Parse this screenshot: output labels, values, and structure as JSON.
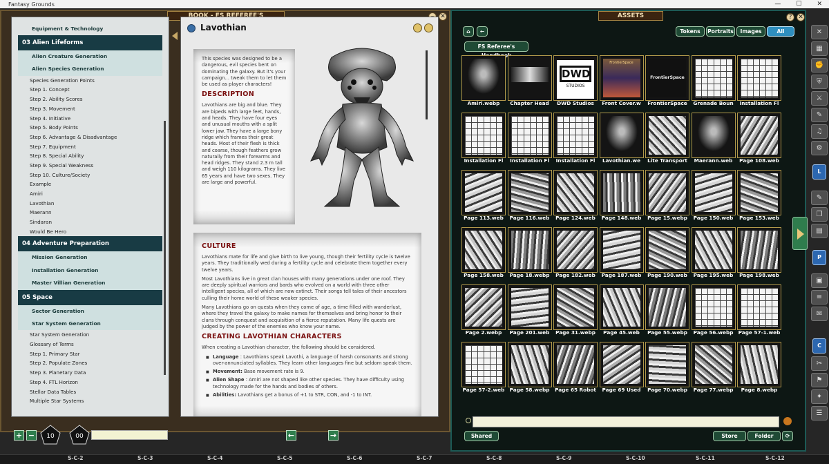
{
  "app": {
    "title": "Fantasy Grounds",
    "minimize": "—",
    "maximize": "☐",
    "close": "✕"
  },
  "book": {
    "title": "BOOK - FS REFEREE'S HANDBOOK",
    "toc": [
      {
        "level": "top",
        "label": "Equipment & Technology"
      },
      {
        "level": 1,
        "label": "03 Alien Lifeforms"
      },
      {
        "level": 2,
        "label": "Alien Creature Generation"
      },
      {
        "level": 2,
        "label": "Alien Species Generation"
      },
      {
        "level": 3,
        "label": "Species Generation Points"
      },
      {
        "level": 3,
        "label": "Step 1. Concept"
      },
      {
        "level": 3,
        "label": "Step 2. Ability Scores"
      },
      {
        "level": 3,
        "label": "Step 3. Movement"
      },
      {
        "level": 3,
        "label": "Step 4. Initiative"
      },
      {
        "level": 3,
        "label": "Step 5. Body Points"
      },
      {
        "level": 3,
        "label": "Step 6. Advantage & Disadvantage"
      },
      {
        "level": 3,
        "label": "Step 7. Equipment"
      },
      {
        "level": 3,
        "label": "Step 8. Special Ability"
      },
      {
        "level": 3,
        "label": "Step 9. Special Weakness"
      },
      {
        "level": 3,
        "label": "Step 10. Culture/Society"
      },
      {
        "level": 3,
        "label": "Example"
      },
      {
        "level": 3,
        "label": "Amiri"
      },
      {
        "level": 3,
        "label": "Lavothian"
      },
      {
        "level": 3,
        "label": "Maerann"
      },
      {
        "level": 3,
        "label": "Sindaran"
      },
      {
        "level": 3,
        "label": "Would Be Hero"
      },
      {
        "level": 1,
        "label": "04 Adventure Preparation"
      },
      {
        "level": 2,
        "label": "Mission Generation"
      },
      {
        "level": 2,
        "label": "Installation Generation"
      },
      {
        "level": 2,
        "label": "Master Villian Generation"
      },
      {
        "level": 1,
        "label": "05 Space"
      },
      {
        "level": 2,
        "label": "Sector Generation"
      },
      {
        "level": 2,
        "label": "Star System Generation"
      },
      {
        "level": 3,
        "label": "Star System Generation"
      },
      {
        "level": 3,
        "label": "Glossary of Terms"
      },
      {
        "level": 3,
        "label": "Step 1. Primary Star"
      },
      {
        "level": 3,
        "label": "Step 2. Populate Zones"
      },
      {
        "level": 3,
        "label": "Step 3. Planetary Data"
      },
      {
        "level": 3,
        "label": "Step 4. FTL Horizon"
      },
      {
        "level": 3,
        "label": "Stellar Data Tables"
      },
      {
        "level": 3,
        "label": "Multiple Star Systems"
      }
    ],
    "page": {
      "title": "Lavothian",
      "intro": "This species was designed to be a dangerous, evil species bent on dominating the galaxy. But it's your campaign... tweak them to let them be used as player characters!",
      "description_heading": "DESCRIPTION",
      "description": "Lavothians are big and blue. They are bipeds with large feet, hands, and heads. They have four eyes and unusual mouths with a split lower jaw. They have a large bony ridge which frames their great heads. Most of their flesh is thick and coarse, though feathers grow naturally from their forearms and head ridges. They stand 2.3 m tall and weigh 110 kilograms. They live 65 years and have two sexes. They are large and powerful.",
      "culture_heading": "CULTURE",
      "culture_p1": "Lavothians mate for life and give birth to live young, though their fertility cycle is twelve years. They traditionally wed during a fertility cycle and celebrate them together every twelve years.",
      "culture_p2": "Most Lavothians live in great clan houses with many generations under one roof. They are deeply spiritual warriors and bards who evolved on a world with three other intelligent species, all of which are now extinct. Their songs tell tales of their ancestors culling their home world of these weaker species.",
      "culture_p3": "Many Lavothians go on quests when they come of age, a time filled with wanderlust, where they travel the galaxy to make names for themselves and bring honor to their clans through conquest and acquisition of a fierce reputation. Many life quests are judged by the power of the enemies who know your name.",
      "creating_heading": "CREATING LAVOTHIAN CHARACTERS",
      "creating_intro": "When creating a Lavothian character, the following should be considered.",
      "bullets": [
        {
          "term": "Language",
          "text": " : Lavothians speak Lavothi, a language of harsh consonants and strong over-annunciated syllables. They learn other languages fine but seldom speak them."
        },
        {
          "term": "Movement:",
          "text": " Base movement rate is 9."
        },
        {
          "term": "Alien Shape",
          "text": " : Amiri are not shaped like other species. They have difficulty using technology made for the hands and bodies of others."
        },
        {
          "term": "Abilities:",
          "text": " Lavothians get a bonus of +1 to STR, CON, and -1 to INT."
        }
      ]
    },
    "dice": {
      "d10": "10",
      "d100": "00"
    },
    "plus": "+",
    "minus": "−",
    "prev": "←",
    "next": "→"
  },
  "assets": {
    "title": "ASSETS",
    "filters": {
      "tokens": "Tokens",
      "portraits": "Portraits",
      "images": "Images",
      "all": "All"
    },
    "breadcrumb": "FS Referee's Handbook",
    "home_icon": "⌂",
    "back_icon": "←",
    "items": [
      "Amiri.webp",
      "Chapter Head",
      "DWD Studios",
      "Front Cover.w",
      "FrontierSpace",
      "Grenade Boun",
      "Installation Fl",
      "Installation Fl",
      "Installation Fl",
      "Installation Fl",
      "Lavothian.we",
      "Lite Transport",
      "Maerann.web",
      "Page 108.web",
      "Page 113.web",
      "Page 116.web",
      "Page 124.web",
      "Page 148.web",
      "Page 15.webp",
      "Page 150.web",
      "Page 153.web",
      "Page 158.web",
      "Page 18.webp",
      "Page 182.web",
      "Page 187.web",
      "Page 190.web",
      "Page 195.web",
      "Page 198.web",
      "Page 2.webp",
      "Page 201.web",
      "Page 31.webp",
      "Page 45.web",
      "Page 55.webp",
      "Page 56.webp",
      "Page 57-1.web",
      "Page 57-2.web",
      "Page 58.webp",
      "Page 65 Robot",
      "Page 69 Used",
      "Page 70.webp",
      "Page 77.webp",
      "Page 8.webp"
    ],
    "thumb_text": {
      "dwd": "DWD",
      "dwd_sub": "STUDIOS",
      "frontier": "FrontierSpace",
      "front_cover": "FrontierSpace"
    },
    "shared": "Shared",
    "store": "Store",
    "folder": "Folder"
  },
  "sidebar": {
    "tabs": [
      "L",
      "P",
      "C"
    ]
  },
  "bottombar": {
    "slots": [
      "S-C-2",
      "S-C-3",
      "S-C-4",
      "S-C-5",
      "S-C-6",
      "S-C-7",
      "S-C-8",
      "S-C-9",
      "S-C-10",
      "S-C-11",
      "S-C-12"
    ]
  }
}
